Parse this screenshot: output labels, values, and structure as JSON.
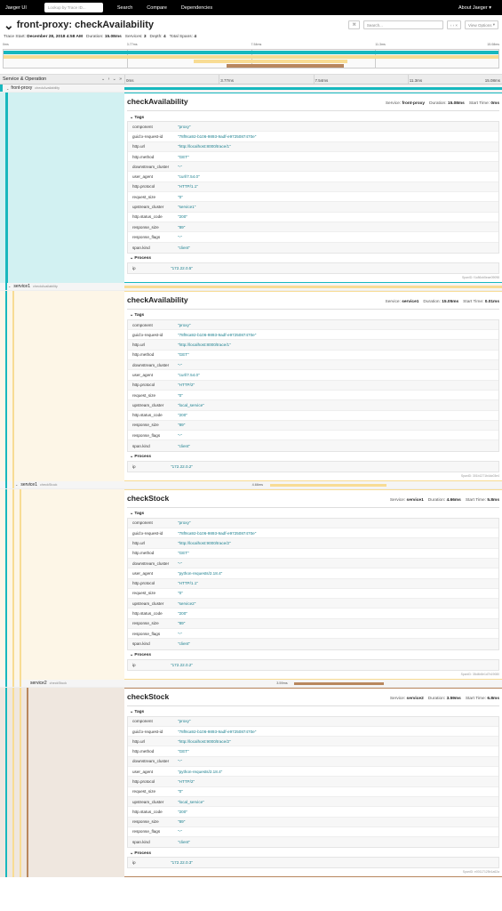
{
  "nav": {
    "brand": "Jaeger UI",
    "lookup_placeholder": "Lookup by Trace ID...",
    "links": [
      "Search",
      "Compare",
      "Dependencies"
    ],
    "about": "About Jaeger"
  },
  "trace": {
    "title": "front-proxy: checkAvailability",
    "search_placeholder": "Search...",
    "view_options": "View Options",
    "meta": {
      "trace_start_label": "Trace Start:",
      "trace_start": "December 28, 2018 4:58 AM",
      "duration_label": "Duration:",
      "duration": "15.08ms",
      "services_label": "Services:",
      "services": "3",
      "depth_label": "Depth:",
      "depth": "4",
      "total_spans_label": "Total Spans:",
      "total_spans": "4"
    }
  },
  "ticks": [
    "0ms",
    "3.77ms",
    "7.54ms",
    "11.3ms",
    "15.08ms"
  ],
  "header": {
    "service_operation": "Service & Operation"
  },
  "colors": {
    "teal": "#17b8be",
    "yellow": "#f8dc94",
    "tan": "#b8875e"
  },
  "spans": [
    {
      "service": "front-proxy",
      "operation": "checkAvailability",
      "bar_label": "",
      "detail": {
        "operation": "checkAvailability",
        "service_label": "Service:",
        "service": "front-proxy",
        "duration_label": "Duration:",
        "duration": "15.08ms",
        "start_label": "Start Time:",
        "start": "0ms",
        "tags_title": "Tags",
        "tags": [
          {
            "k": "component",
            "v": "\"proxy\""
          },
          {
            "k": "guid:x-request-id",
            "v": "\"78f9ca92-b106-9893-9adf-e9725087470e\""
          },
          {
            "k": "http.url",
            "v": "\"http://localhost:8000/trace/1\""
          },
          {
            "k": "http.method",
            "v": "\"GET\""
          },
          {
            "k": "downstream_cluster",
            "v": "\"-\""
          },
          {
            "k": "user_agent",
            "v": "\"curl/7.54.0\""
          },
          {
            "k": "http.protocol",
            "v": "\"HTTP/1.1\""
          },
          {
            "k": "request_size",
            "v": "\"0\""
          },
          {
            "k": "upstream_cluster",
            "v": "\"service1\""
          },
          {
            "k": "http.status_code",
            "v": "\"200\""
          },
          {
            "k": "response_size",
            "v": "\"89\""
          },
          {
            "k": "response_flags",
            "v": "\"-\""
          },
          {
            "k": "span.kind",
            "v": "\"client\""
          }
        ],
        "process_title": "Process",
        "process": [
          {
            "k": "ip",
            "v": "\"172.22.0.5\""
          }
        ],
        "span_id": "SpanID: f1c86cb5eae09098"
      }
    },
    {
      "service": "service1",
      "operation": "checkAvailability",
      "bar_label": "",
      "detail": {
        "operation": "checkAvailability",
        "service_label": "Service:",
        "service": "service1",
        "duration_label": "Duration:",
        "duration": "15.05ms",
        "start_label": "Start Time:",
        "start": "0.01ms",
        "tags_title": "Tags",
        "tags": [
          {
            "k": "component",
            "v": "\"proxy\""
          },
          {
            "k": "guid:x-request-id",
            "v": "\"78f9ca92-b106-9893-9adf-e9725087470e\""
          },
          {
            "k": "http.url",
            "v": "\"http://localhost:8000/trace/1\""
          },
          {
            "k": "http.method",
            "v": "\"GET\""
          },
          {
            "k": "downstream_cluster",
            "v": "\"-\""
          },
          {
            "k": "user_agent",
            "v": "\"curl/7.54.0\""
          },
          {
            "k": "http.protocol",
            "v": "\"HTTP/2\""
          },
          {
            "k": "request_size",
            "v": "\"0\""
          },
          {
            "k": "upstream_cluster",
            "v": "\"local_service\""
          },
          {
            "k": "http.status_code",
            "v": "\"200\""
          },
          {
            "k": "response_size",
            "v": "\"89\""
          },
          {
            "k": "response_flags",
            "v": "\"-\""
          },
          {
            "k": "span.kind",
            "v": "\"client\""
          }
        ],
        "process_title": "Process",
        "process": [
          {
            "k": "ip",
            "v": "\"172.22.0.2\""
          }
        ],
        "span_id": "SpanID: 301b1271b4dc03e4"
      }
    },
    {
      "service": "service1",
      "operation": "checkStock",
      "bar_label": "4.66ms",
      "detail": {
        "operation": "checkStock",
        "service_label": "Service:",
        "service": "service1",
        "duration_label": "Duration:",
        "duration": "4.66ms",
        "start_label": "Start Time:",
        "start": "5.8ms",
        "tags_title": "Tags",
        "tags": [
          {
            "k": "component",
            "v": "\"proxy\""
          },
          {
            "k": "guid:x-request-id",
            "v": "\"78f9ca92-b106-9893-9adf-e9725087470e\""
          },
          {
            "k": "http.url",
            "v": "\"http://localhost:9000/trace/2\""
          },
          {
            "k": "http.method",
            "v": "\"GET\""
          },
          {
            "k": "downstream_cluster",
            "v": "\"-\""
          },
          {
            "k": "user_agent",
            "v": "\"python-requests/2.18.4\""
          },
          {
            "k": "http.protocol",
            "v": "\"HTTP/1.1\""
          },
          {
            "k": "request_size",
            "v": "\"0\""
          },
          {
            "k": "upstream_cluster",
            "v": "\"service2\""
          },
          {
            "k": "http.status_code",
            "v": "\"200\""
          },
          {
            "k": "response_size",
            "v": "\"89\""
          },
          {
            "k": "response_flags",
            "v": "\"-\""
          },
          {
            "k": "span.kind",
            "v": "\"client\""
          }
        ],
        "process_title": "Process",
        "process": [
          {
            "k": "ip",
            "v": "\"172.22.0.2\""
          }
        ],
        "span_id": "SpanID: 35d4b8e1d7b19080"
      }
    },
    {
      "service": "service2",
      "operation": "checkStock",
      "bar_label": "3.59ms",
      "detail": {
        "operation": "checkStock",
        "service_label": "Service:",
        "service": "service2",
        "duration_label": "Duration:",
        "duration": "3.59ms",
        "start_label": "Start Time:",
        "start": "6.8ms",
        "tags_title": "Tags",
        "tags": [
          {
            "k": "component",
            "v": "\"proxy\""
          },
          {
            "k": "guid:x-request-id",
            "v": "\"78f9ca92-b106-9893-9adf-e9725087470e\""
          },
          {
            "k": "http.url",
            "v": "\"http://localhost:9000/trace/2\""
          },
          {
            "k": "http.method",
            "v": "\"GET\""
          },
          {
            "k": "downstream_cluster",
            "v": "\"-\""
          },
          {
            "k": "user_agent",
            "v": "\"python-requests/2.18.4\""
          },
          {
            "k": "http.protocol",
            "v": "\"HTTP/2\""
          },
          {
            "k": "request_size",
            "v": "\"0\""
          },
          {
            "k": "upstream_cluster",
            "v": "\"local_service\""
          },
          {
            "k": "http.status_code",
            "v": "\"200\""
          },
          {
            "k": "response_size",
            "v": "\"89\""
          },
          {
            "k": "response_flags",
            "v": "\"-\""
          },
          {
            "k": "span.kind",
            "v": "\"client\""
          }
        ],
        "process_title": "Process",
        "process": [
          {
            "k": "ip",
            "v": "\"172.22.0.3\""
          }
        ],
        "span_id": "SpanID: e00117125b1a62a"
      }
    }
  ]
}
